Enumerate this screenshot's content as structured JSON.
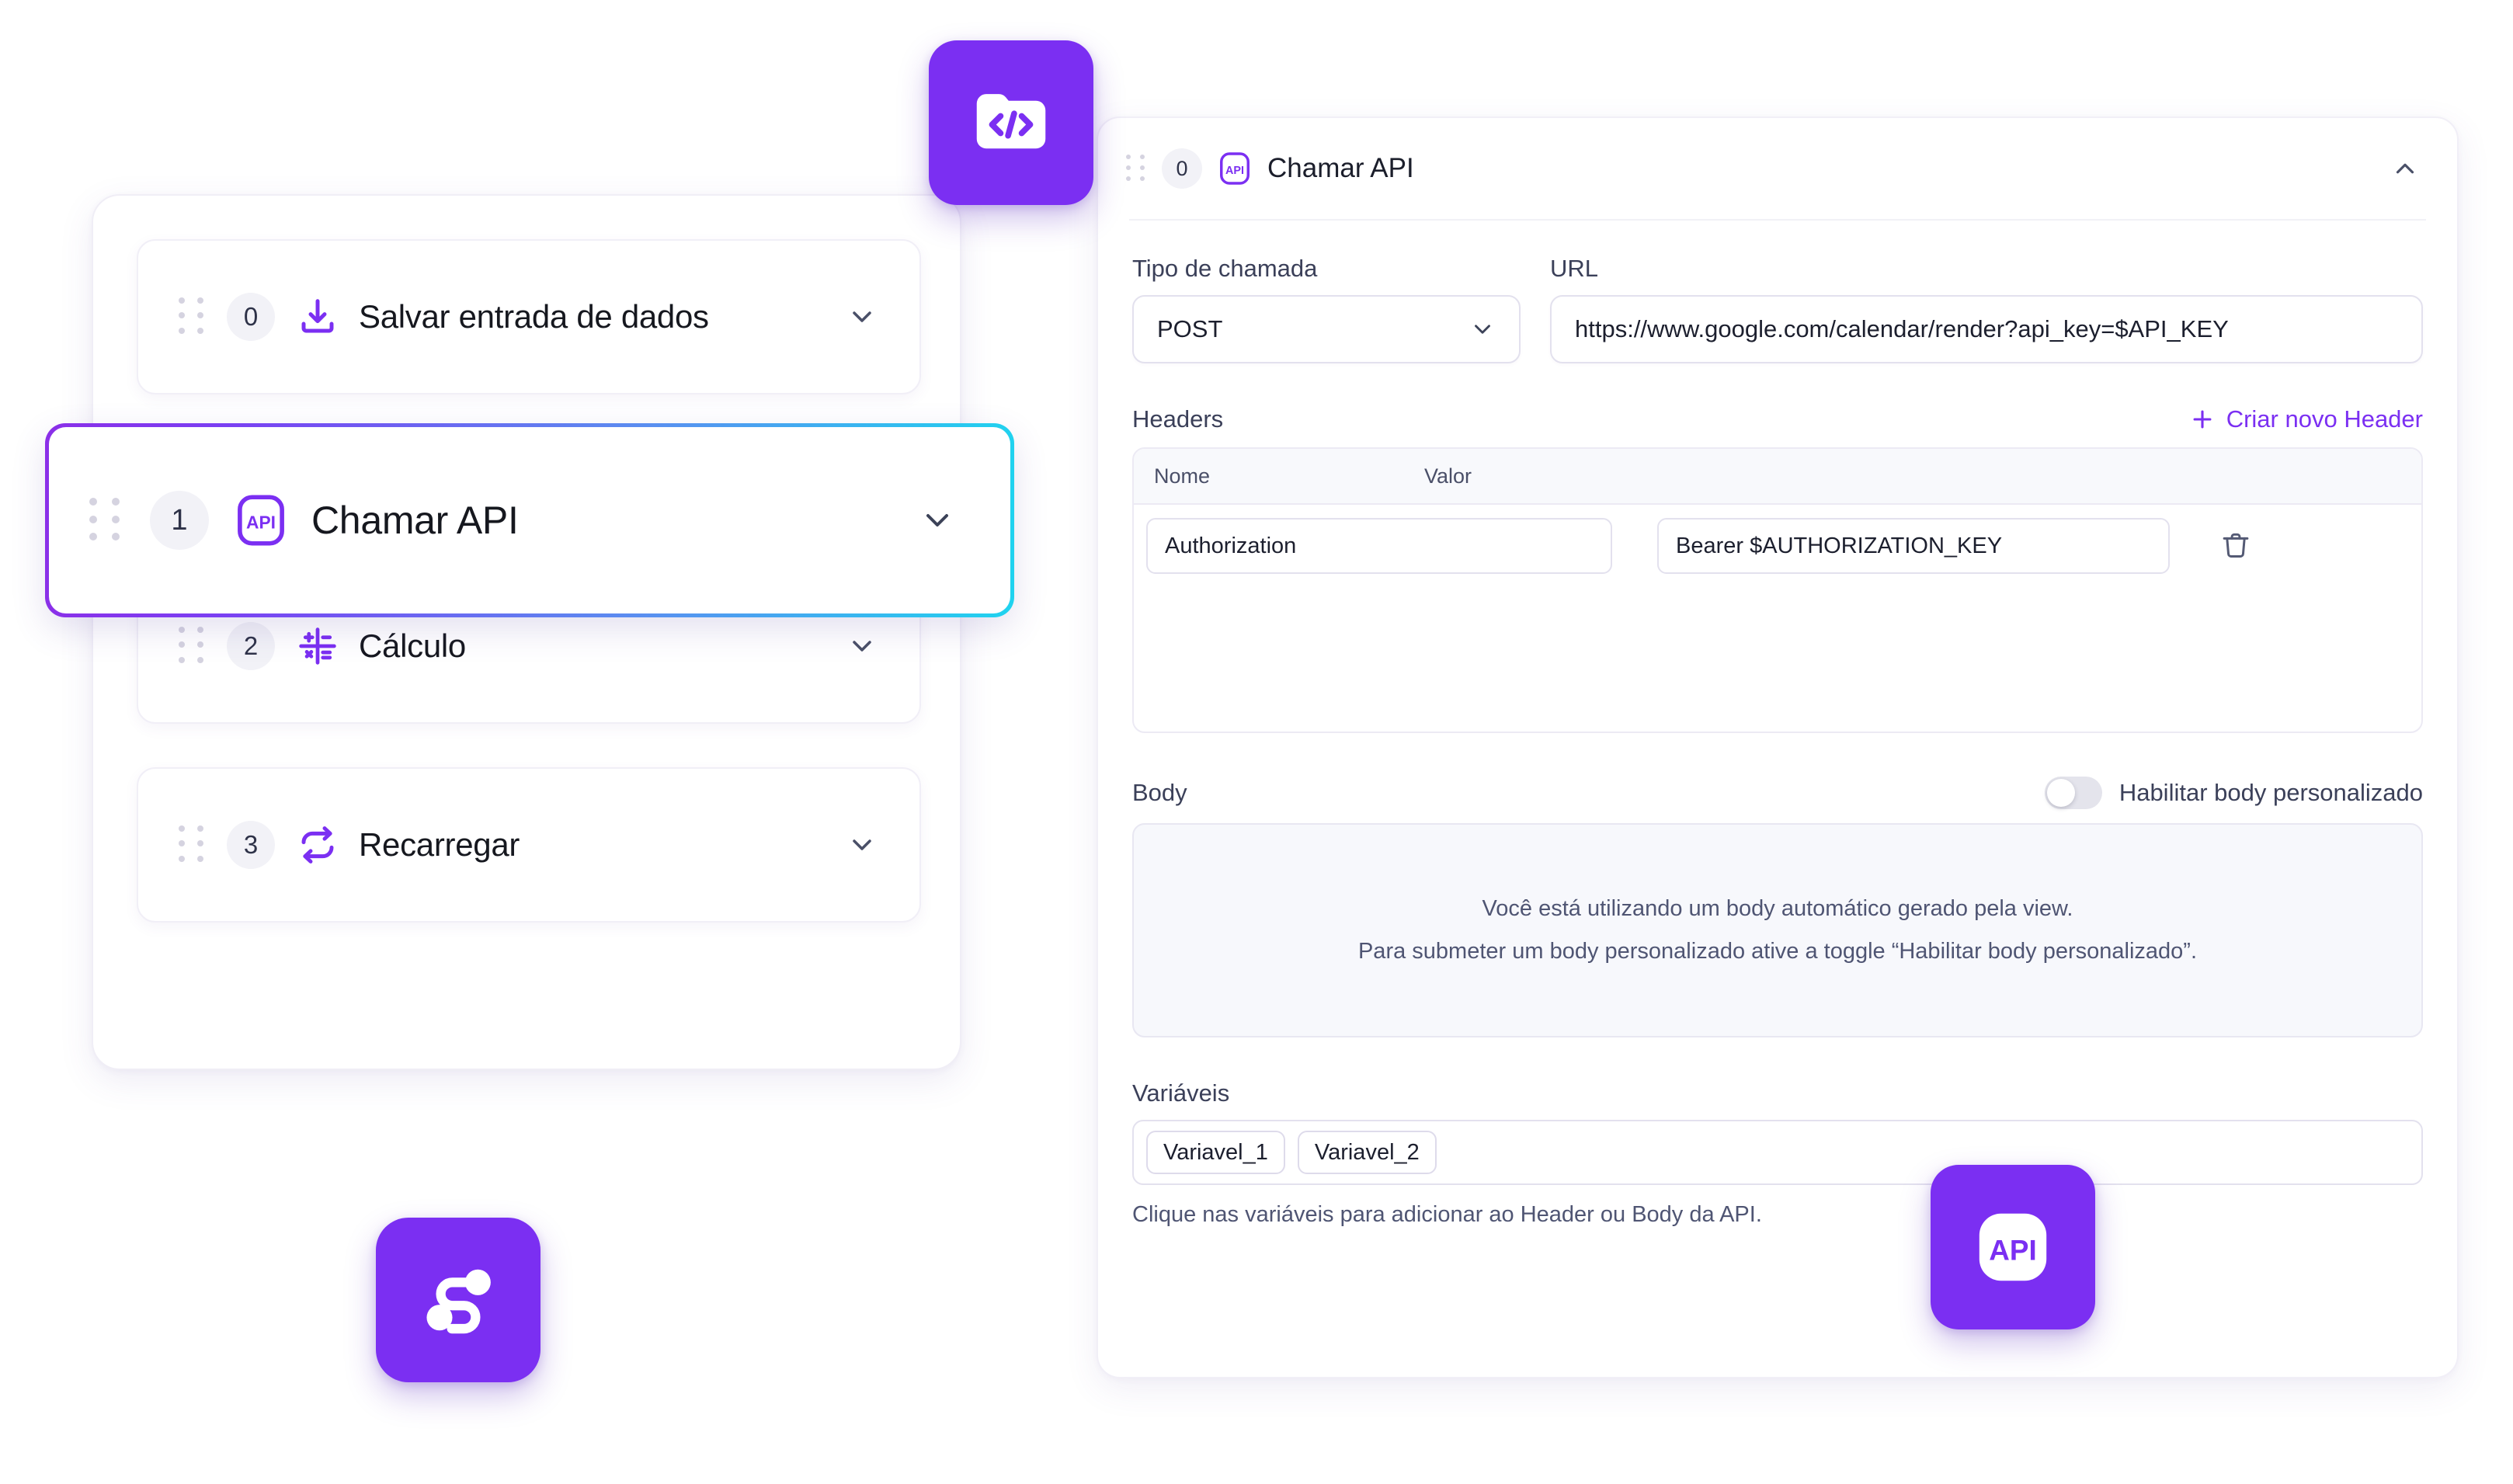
{
  "colors": {
    "accent_purple": "#7b2ff2",
    "gradient_start": "#8b2fe8",
    "gradient_end": "#1fd3ef",
    "text_dark": "#16181f",
    "text_muted": "#4f5573",
    "panel_border": "#f1eff7",
    "field_border": "#e3e1ee"
  },
  "left_panel": {
    "steps": [
      {
        "index": "0",
        "label": "Salvar entrada de dados",
        "icon": "download-icon",
        "selected": false,
        "chevron": "chevron-down-icon"
      },
      {
        "index": "1",
        "label": "Chamar API",
        "icon": "api-icon",
        "selected": true,
        "chevron": "chevron-down-icon"
      },
      {
        "index": "2",
        "label": "Cálculo",
        "icon": "calculator-icon",
        "selected": false,
        "chevron": "chevron-down-icon"
      },
      {
        "index": "3",
        "label": "Recarregar",
        "icon": "refresh-icon",
        "selected": false,
        "chevron": "chevron-down-icon"
      }
    ],
    "drag_handle_icon": "drag-handle-icon"
  },
  "right_panel": {
    "header": {
      "index": "0",
      "title": "Chamar API",
      "icon": "api-icon",
      "collapse_icon": "chevron-up-icon",
      "drag_handle_icon": "drag-handle-icon"
    },
    "call_type": {
      "label": "Tipo de chamada",
      "value": "POST",
      "chevron": "chevron-down-icon"
    },
    "url": {
      "label": "URL",
      "value": "https://www.google.com/calendar/render?api_key=$API_KEY"
    },
    "headers": {
      "label": "Headers",
      "create_button": "Criar novo Header",
      "create_icon": "plus-icon",
      "columns": [
        "Nome",
        "Valor"
      ],
      "rows": [
        {
          "name": "Authorization",
          "value": "Bearer $AUTHORIZATION_KEY",
          "delete_icon": "trash-icon"
        }
      ]
    },
    "body": {
      "label": "Body",
      "toggle_label": "Habilitar body personalizado",
      "toggle_state": "off",
      "info_line_1": "Você está utilizando um body automático gerado pela view.",
      "info_line_2": "Para submeter um body personalizado ative a toggle “Habilitar body personalizado”."
    },
    "variables": {
      "label": "Variáveis",
      "chips": [
        "Variavel_1",
        "Variavel_2"
      ],
      "hint": "Clique nas variáveis para adicionar ao Header ou Body da API."
    }
  },
  "floating_badges": [
    {
      "name": "code-folder-badge",
      "icon": "folder-code-icon"
    },
    {
      "name": "api-badge",
      "icon": "api-icon"
    },
    {
      "name": "brand-logo-badge",
      "icon": "brand-s-logo-icon"
    }
  ]
}
